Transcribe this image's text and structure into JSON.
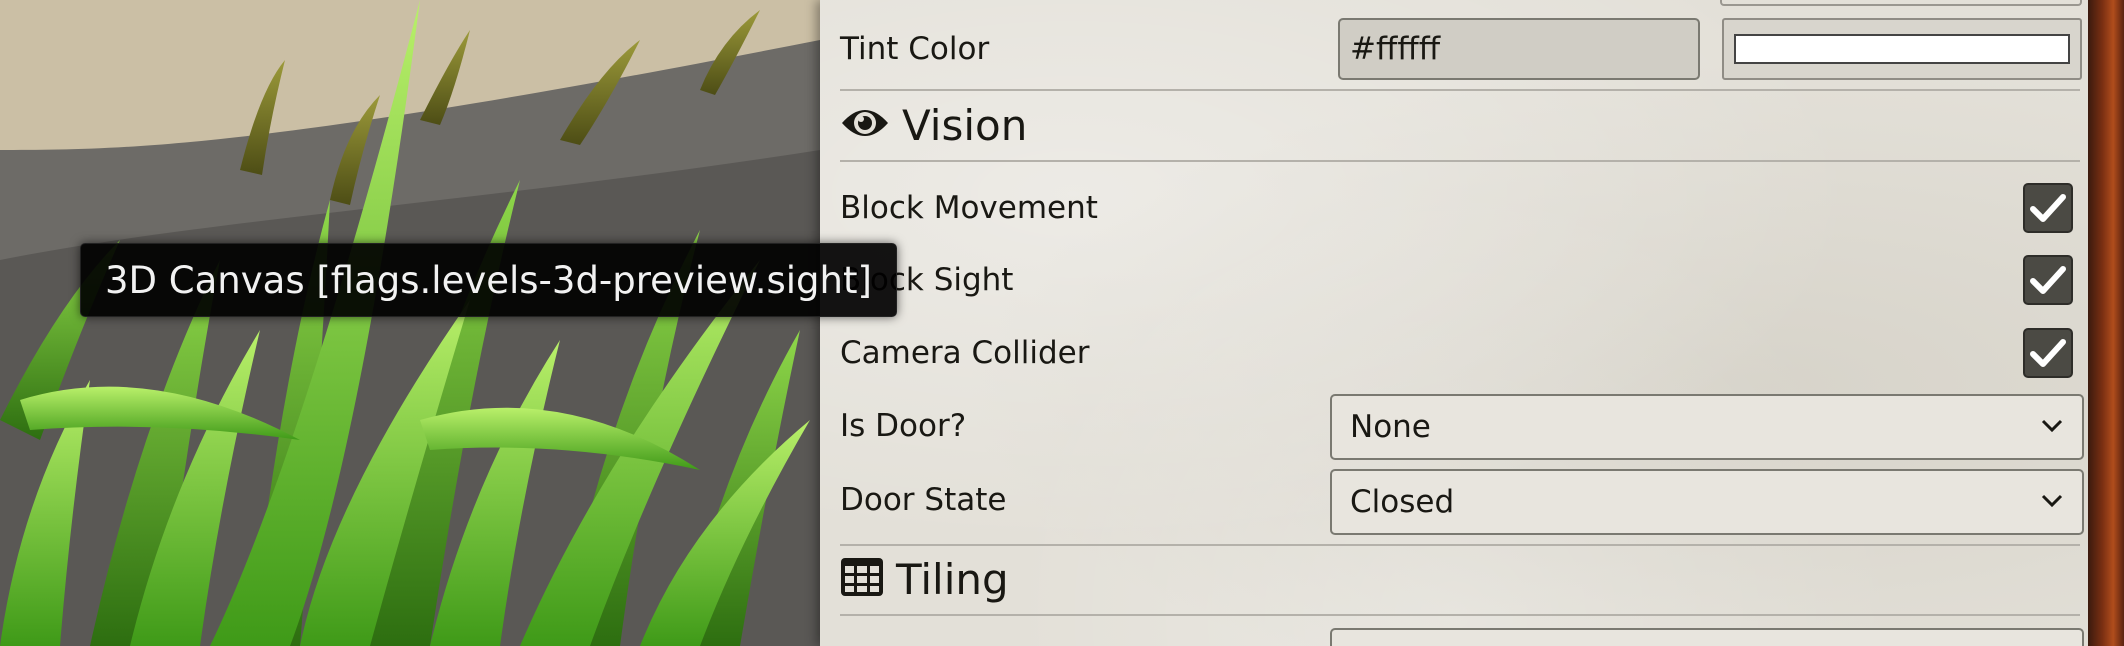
{
  "tooltip": {
    "text": "3D Canvas [flags.levels-3d-preview.sight]"
  },
  "tint": {
    "label": "Tint Color",
    "value": "#ffffff",
    "swatch_color": "#ffffff"
  },
  "sections": {
    "vision": {
      "title": "Vision",
      "icon": "eye-icon"
    },
    "tiling": {
      "title": "Tiling",
      "icon": "grid-table-icon"
    }
  },
  "checkboxes": [
    {
      "label": "Block Movement",
      "checked": true
    },
    {
      "label": "Block Sight",
      "checked": true
    },
    {
      "label": "Camera Collider",
      "checked": true
    }
  ],
  "selects": {
    "is_door": {
      "label": "Is Door?",
      "value": "None"
    },
    "door_state": {
      "label": "Door State",
      "value": "Closed"
    }
  },
  "colors": {
    "panel_bg": "#e3e0d8",
    "checkbox_bg": "#4b4a44",
    "frame_accent": "#b04d1c"
  }
}
